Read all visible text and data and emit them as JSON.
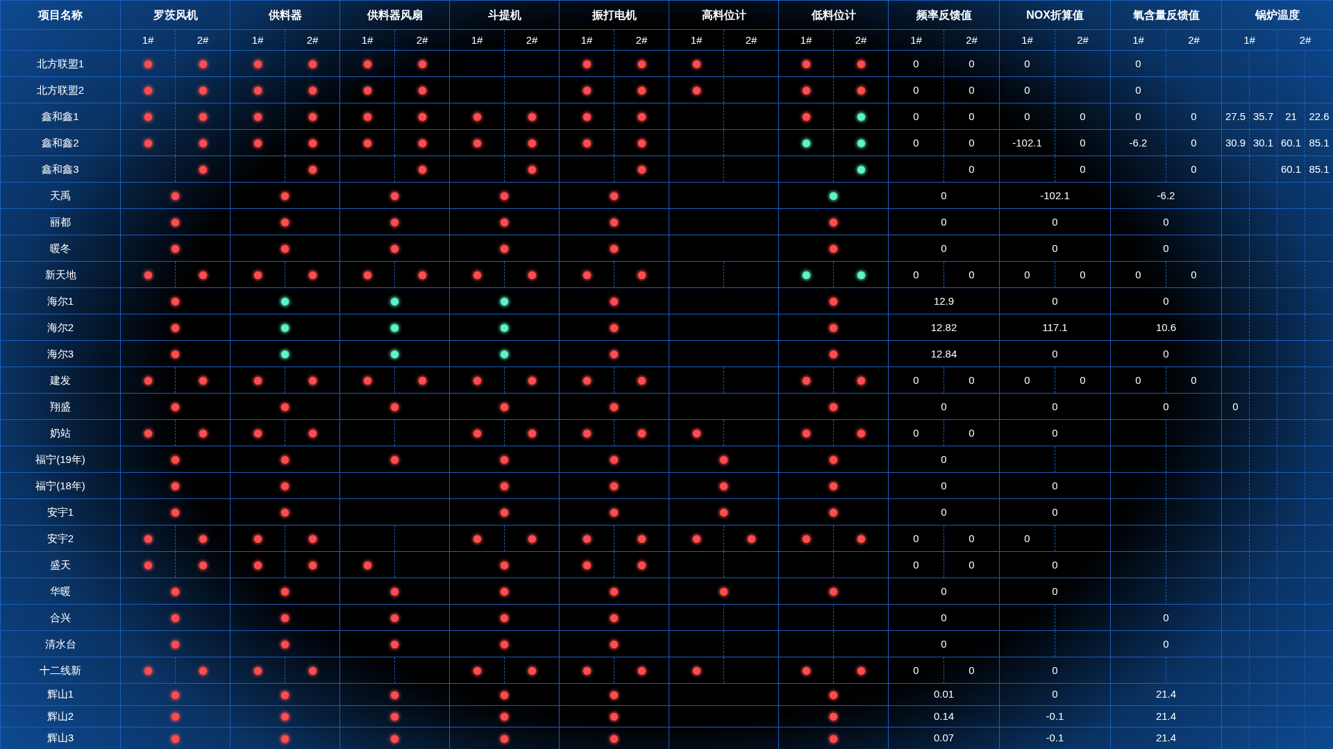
{
  "header": {
    "name_column": "项目名称",
    "indicator_groups": [
      {
        "title": "罗茨风机",
        "subs": [
          "1#",
          "2#"
        ]
      },
      {
        "title": "供料器",
        "subs": [
          "1#",
          "2#"
        ]
      },
      {
        "title": "供料器风扇",
        "subs": [
          "1#",
          "2#"
        ]
      },
      {
        "title": "斗提机",
        "subs": [
          "1#",
          "2#"
        ]
      },
      {
        "title": "振打电机",
        "subs": [
          "1#",
          "2#"
        ]
      },
      {
        "title": "高料位计",
        "subs": [
          "1#",
          "2#"
        ]
      },
      {
        "title": "低料位计",
        "subs": [
          "1#",
          "2#"
        ]
      }
    ],
    "reading_groups": [
      {
        "title": "频率反馈值",
        "subs": [
          "1#",
          "2#"
        ]
      },
      {
        "title": "NOX折算值",
        "subs": [
          "1#",
          "2#"
        ]
      },
      {
        "title": "氧含量反馈值",
        "subs": [
          "1#",
          "2#"
        ]
      }
    ],
    "temperature_group": {
      "title": "锅炉温度",
      "subs": [
        "1#",
        "2#"
      ]
    }
  },
  "rows": [
    {
      "name": "北方联盟1",
      "indicators": [
        {
          "split": true,
          "first": {
            "color": "#ff4d4f"
          },
          "second": {
            "color": "#ff4d4f"
          }
        },
        {
          "split": true,
          "first": {
            "color": "#ff4d4f"
          },
          "second": {
            "color": "#ff4d4f"
          }
        },
        {
          "split": true,
          "first": {
            "color": "#ff4d4f"
          },
          "second": {
            "color": "#ff4d4f"
          }
        },
        {
          "split": true
        },
        {
          "split": true,
          "first": {
            "color": "#ff4d4f"
          },
          "second": {
            "color": "#ff4d4f"
          }
        },
        {
          "split": true,
          "first": {
            "color": "#ff4d4f"
          }
        },
        {
          "split": true,
          "first": {
            "color": "#ff4d4f"
          },
          "second": {
            "color": "#ff4d4f"
          }
        }
      ],
      "readings": [
        {
          "split": true,
          "first": "0",
          "second": "0"
        },
        {
          "split": true,
          "first": "0"
        },
        {
          "split": true,
          "first": "0"
        }
      ]
    },
    {
      "name": "北方联盟2",
      "indicators": [
        {
          "split": true,
          "first": {
            "color": "#ff4d4f"
          },
          "second": {
            "color": "#ff4d4f"
          }
        },
        {
          "split": true,
          "first": {
            "color": "#ff4d4f"
          },
          "second": {
            "color": "#ff4d4f"
          }
        },
        {
          "split": true,
          "first": {
            "color": "#ff4d4f"
          },
          "second": {
            "color": "#ff4d4f"
          }
        },
        {
          "split": true
        },
        {
          "split": true,
          "first": {
            "color": "#ff4d4f"
          },
          "second": {
            "color": "#ff4d4f"
          }
        },
        {
          "split": true,
          "first": {
            "color": "#ff4d4f"
          }
        },
        {
          "split": true,
          "first": {
            "color": "#ff4d4f"
          },
          "second": {
            "color": "#ff4d4f"
          }
        }
      ],
      "readings": [
        {
          "split": true,
          "first": "0",
          "second": "0"
        },
        {
          "split": true,
          "first": "0"
        },
        {
          "split": true,
          "first": "0"
        }
      ]
    },
    {
      "name": "鑫和鑫1",
      "indicators": [
        {
          "split": true,
          "first": {
            "color": "#ff4d4f"
          },
          "second": {
            "color": "#ff4d4f"
          }
        },
        {
          "split": true,
          "first": {
            "color": "#ff4d4f"
          },
          "second": {
            "color": "#ff4d4f"
          }
        },
        {
          "split": true,
          "first": {
            "color": "#ff4d4f"
          },
          "second": {
            "color": "#ff4d4f"
          }
        },
        {
          "split": true,
          "first": {
            "color": "#ff4d4f"
          },
          "second": {
            "color": "#ff4d4f"
          }
        },
        {
          "split": true,
          "first": {
            "color": "#ff4d4f"
          },
          "second": {
            "color": "#ff4d4f"
          }
        },
        {
          "split": true
        },
        {
          "split": true,
          "first": {
            "color": "#ff4d4f"
          },
          "second": {
            "color": "#5ff3c8"
          }
        }
      ],
      "readings": [
        {
          "split": true,
          "first": "0",
          "second": "0"
        },
        {
          "split": true,
          "first": "0",
          "second": "0"
        },
        {
          "split": true,
          "first": "0",
          "second": "0"
        }
      ],
      "boiler_temps": {
        "column_1": "27.5",
        "column_2": "35.7",
        "column_3": "21",
        "column_4": "22.6"
      }
    },
    {
      "name": "鑫和鑫2",
      "indicators": [
        {
          "split": true,
          "first": {
            "color": "#ff4d4f"
          },
          "second": {
            "color": "#ff4d4f"
          }
        },
        {
          "split": true,
          "first": {
            "color": "#ff4d4f"
          },
          "second": {
            "color": "#ff4d4f"
          }
        },
        {
          "split": true,
          "first": {
            "color": "#ff4d4f"
          },
          "second": {
            "color": "#ff4d4f"
          }
        },
        {
          "split": true,
          "first": {
            "color": "#ff4d4f"
          },
          "second": {
            "color": "#ff4d4f"
          }
        },
        {
          "split": true,
          "first": {
            "color": "#ff4d4f"
          },
          "second": {
            "color": "#ff4d4f"
          }
        },
        {
          "split": true
        },
        {
          "split": true,
          "first": {
            "color": "#5ff3c8"
          },
          "second": {
            "color": "#5ff3c8"
          }
        }
      ],
      "readings": [
        {
          "split": true,
          "first": "0",
          "second": "0"
        },
        {
          "split": true,
          "first": "-102.1",
          "second": "0"
        },
        {
          "split": true,
          "first": "-6.2",
          "second": "0"
        }
      ],
      "boiler_temps": {
        "column_1": "30.9",
        "column_2": "30.1",
        "column_3": "60.1",
        "column_4": "85.1"
      }
    },
    {
      "name": "鑫和鑫3",
      "indicators": [
        {
          "split": true,
          "second": {
            "color": "#ff4d4f"
          }
        },
        {
          "split": true,
          "second": {
            "color": "#ff4d4f"
          }
        },
        {
          "split": true,
          "second": {
            "color": "#ff4d4f"
          }
        },
        {
          "split": true,
          "second": {
            "color": "#ff4d4f"
          }
        },
        {
          "split": true,
          "second": {
            "color": "#ff4d4f"
          }
        },
        {
          "split": true
        },
        {
          "split": true,
          "second": {
            "color": "#5ff3c8"
          }
        }
      ],
      "readings": [
        {
          "split": true,
          "second": "0"
        },
        {
          "split": true,
          "second": "0"
        },
        {
          "split": true,
          "second": "0"
        }
      ],
      "boiler_temps": {
        "column_3": "60.1",
        "column_4": "85.1"
      }
    },
    {
      "name": "天禹",
      "indicators": [
        {
          "split": false,
          "dot": {
            "color": "#ff4d4f"
          }
        },
        {
          "split": false,
          "dot": {
            "color": "#ff4d4f"
          }
        },
        {
          "split": false,
          "dot": {
            "color": "#ff4d4f"
          }
        },
        {
          "split": false,
          "dot": {
            "color": "#ff4d4f"
          }
        },
        {
          "split": false,
          "dot": {
            "color": "#ff4d4f"
          }
        },
        {
          "split": false
        },
        {
          "split": false,
          "dot": {
            "color": "#5ff3c8"
          }
        }
      ],
      "readings": [
        {
          "split": false,
          "value": "0"
        },
        {
          "split": false,
          "value": "-102.1"
        },
        {
          "split": false,
          "value": "-6.2"
        }
      ]
    },
    {
      "name": "丽都",
      "indicators": [
        {
          "split": false,
          "dot": {
            "color": "#ff4d4f"
          }
        },
        {
          "split": false,
          "dot": {
            "color": "#ff4d4f"
          }
        },
        {
          "split": false,
          "dot": {
            "color": "#ff4d4f"
          }
        },
        {
          "split": false,
          "dot": {
            "color": "#ff4d4f"
          }
        },
        {
          "split": false,
          "dot": {
            "color": "#ff4d4f"
          }
        },
        {
          "split": false
        },
        {
          "split": false,
          "dot": {
            "color": "#ff4d4f"
          }
        }
      ],
      "readings": [
        {
          "split": false,
          "value": "0"
        },
        {
          "split": false,
          "value": "0"
        },
        {
          "split": false,
          "value": "0"
        }
      ]
    },
    {
      "name": "暖冬",
      "indicators": [
        {
          "split": false,
          "dot": {
            "color": "#ff4d4f"
          }
        },
        {
          "split": false,
          "dot": {
            "color": "#ff4d4f"
          }
        },
        {
          "split": false,
          "dot": {
            "color": "#ff4d4f"
          }
        },
        {
          "split": false,
          "dot": {
            "color": "#ff4d4f"
          }
        },
        {
          "split": false,
          "dot": {
            "color": "#ff4d4f"
          }
        },
        {
          "split": false
        },
        {
          "split": false,
          "dot": {
            "color": "#ff4d4f"
          }
        }
      ],
      "readings": [
        {
          "split": false,
          "value": "0"
        },
        {
          "split": false,
          "value": "0"
        },
        {
          "split": false,
          "value": "0"
        }
      ]
    },
    {
      "name": "新天地",
      "indicators": [
        {
          "split": true,
          "first": {
            "color": "#ff4d4f"
          },
          "second": {
            "color": "#ff4d4f"
          }
        },
        {
          "split": true,
          "first": {
            "color": "#ff4d4f"
          },
          "second": {
            "color": "#ff4d4f"
          }
        },
        {
          "split": true,
          "first": {
            "color": "#ff4d4f"
          },
          "second": {
            "color": "#ff4d4f"
          }
        },
        {
          "split": true,
          "first": {
            "color": "#ff4d4f"
          },
          "second": {
            "color": "#ff4d4f"
          }
        },
        {
          "split": true,
          "first": {
            "color": "#ff4d4f"
          },
          "second": {
            "color": "#ff4d4f"
          }
        },
        {
          "split": true
        },
        {
          "split": true,
          "first": {
            "color": "#5ff3c8"
          },
          "second": {
            "color": "#5ff3c8"
          }
        }
      ],
      "readings": [
        {
          "split": true,
          "first": "0",
          "second": "0"
        },
        {
          "split": true,
          "first": "0",
          "second": "0"
        },
        {
          "split": true,
          "first": "0",
          "second": "0"
        }
      ]
    },
    {
      "name": "海尔1",
      "indicators": [
        {
          "split": false,
          "dot": {
            "color": "#ff4d4f"
          }
        },
        {
          "split": false,
          "dot": {
            "color": "#5ff3c8"
          }
        },
        {
          "split": false,
          "dot": {
            "color": "#5ff3c8"
          }
        },
        {
          "split": false,
          "dot": {
            "color": "#5ff3c8"
          }
        },
        {
          "split": false,
          "dot": {
            "color": "#ff4d4f"
          }
        },
        {
          "split": false
        },
        {
          "split": false,
          "dot": {
            "color": "#ff4d4f"
          }
        }
      ],
      "readings": [
        {
          "split": false,
          "value": "12.9"
        },
        {
          "split": false,
          "value": "0"
        },
        {
          "split": false,
          "value": "0"
        }
      ]
    },
    {
      "name": "海尔2",
      "indicators": [
        {
          "split": false,
          "dot": {
            "color": "#ff4d4f"
          }
        },
        {
          "split": false,
          "dot": {
            "color": "#5ff3c8"
          }
        },
        {
          "split": false,
          "dot": {
            "color": "#5ff3c8"
          }
        },
        {
          "split": false,
          "dot": {
            "color": "#5ff3c8"
          }
        },
        {
          "split": false,
          "dot": {
            "color": "#ff4d4f"
          }
        },
        {
          "split": false
        },
        {
          "split": false,
          "dot": {
            "color": "#ff4d4f"
          }
        }
      ],
      "readings": [
        {
          "split": false,
          "value": "12.82"
        },
        {
          "split": false,
          "value": "117.1"
        },
        {
          "split": false,
          "value": "10.6"
        }
      ]
    },
    {
      "name": "海尔3",
      "indicators": [
        {
          "split": false,
          "dot": {
            "color": "#ff4d4f"
          }
        },
        {
          "split": false,
          "dot": {
            "color": "#5ff3c8"
          }
        },
        {
          "split": false,
          "dot": {
            "color": "#5ff3c8"
          }
        },
        {
          "split": false,
          "dot": {
            "color": "#5ff3c8"
          }
        },
        {
          "split": false,
          "dot": {
            "color": "#ff4d4f"
          }
        },
        {
          "split": false
        },
        {
          "split": false,
          "dot": {
            "color": "#ff4d4f"
          }
        }
      ],
      "readings": [
        {
          "split": false,
          "value": "12.84"
        },
        {
          "split": false,
          "value": "0"
        },
        {
          "split": false,
          "value": "0"
        }
      ]
    },
    {
      "name": "建发",
      "indicators": [
        {
          "split": true,
          "first": {
            "color": "#ff4d4f"
          },
          "second": {
            "color": "#ff4d4f"
          }
        },
        {
          "split": true,
          "first": {
            "color": "#ff4d4f"
          },
          "second": {
            "color": "#ff4d4f"
          }
        },
        {
          "split": true,
          "first": {
            "color": "#ff4d4f"
          },
          "second": {
            "color": "#ff4d4f"
          }
        },
        {
          "split": true,
          "first": {
            "color": "#ff4d4f"
          },
          "second": {
            "color": "#ff4d4f"
          }
        },
        {
          "split": true,
          "first": {
            "color": "#ff4d4f"
          },
          "second": {
            "color": "#ff4d4f"
          }
        },
        {
          "split": true
        },
        {
          "split": true,
          "first": {
            "color": "#ff4d4f"
          },
          "second": {
            "color": "#ff4d4f"
          }
        }
      ],
      "readings": [
        {
          "split": true,
          "first": "0",
          "second": "0"
        },
        {
          "split": true,
          "first": "0",
          "second": "0"
        },
        {
          "split": true,
          "first": "0",
          "second": "0"
        }
      ]
    },
    {
      "name": "翔盛",
      "indicators": [
        {
          "split": false,
          "dot": {
            "color": "#ff4d4f"
          }
        },
        {
          "split": false,
          "dot": {
            "color": "#ff4d4f"
          }
        },
        {
          "split": false,
          "dot": {
            "color": "#ff4d4f"
          }
        },
        {
          "split": false,
          "dot": {
            "color": "#ff4d4f"
          }
        },
        {
          "split": false,
          "dot": {
            "color": "#ff4d4f"
          }
        },
        {
          "split": false
        },
        {
          "split": false,
          "dot": {
            "color": "#ff4d4f"
          }
        }
      ],
      "readings": [
        {
          "split": false,
          "value": "0"
        },
        {
          "split": false,
          "value": "0"
        },
        {
          "split": false,
          "value": "0"
        }
      ],
      "boiler_temps": {
        "column_1": "0"
      }
    },
    {
      "name": "奶站",
      "indicators": [
        {
          "split": true,
          "first": {
            "color": "#ff4d4f"
          },
          "second": {
            "color": "#ff4d4f"
          }
        },
        {
          "split": true,
          "first": {
            "color": "#ff4d4f"
          },
          "second": {
            "color": "#ff4d4f"
          }
        },
        {
          "split": true
        },
        {
          "split": true,
          "first": {
            "color": "#ff4d4f"
          },
          "second": {
            "color": "#ff4d4f"
          }
        },
        {
          "split": true,
          "first": {
            "color": "#ff4d4f"
          },
          "second": {
            "color": "#ff4d4f"
          }
        },
        {
          "split": true,
          "first": {
            "color": "#ff4d4f"
          }
        },
        {
          "split": true,
          "first": {
            "color": "#ff4d4f"
          },
          "second": {
            "color": "#ff4d4f"
          }
        }
      ],
      "readings": [
        {
          "split": true,
          "first": "0",
          "second": "0"
        },
        {
          "split": false,
          "value": "0"
        },
        {
          "split": true
        }
      ]
    },
    {
      "name": "福宁(19年)",
      "indicators": [
        {
          "split": false,
          "dot": {
            "color": "#ff4d4f"
          }
        },
        {
          "split": false,
          "dot": {
            "color": "#ff4d4f"
          }
        },
        {
          "split": false,
          "dot": {
            "color": "#ff4d4f"
          }
        },
        {
          "split": false,
          "dot": {
            "color": "#ff4d4f"
          }
        },
        {
          "split": false,
          "dot": {
            "color": "#ff4d4f"
          }
        },
        {
          "split": false,
          "dot": {
            "color": "#ff4d4f"
          }
        },
        {
          "split": false,
          "dot": {
            "color": "#ff4d4f"
          }
        }
      ],
      "readings": [
        {
          "split": false,
          "value": "0"
        },
        {
          "split": true
        },
        {
          "split": true
        }
      ]
    },
    {
      "name": "福宁(18年)",
      "indicators": [
        {
          "split": false,
          "dot": {
            "color": "#ff4d4f"
          }
        },
        {
          "split": false,
          "dot": {
            "color": "#ff4d4f"
          }
        },
        {
          "split": false
        },
        {
          "split": false,
          "dot": {
            "color": "#ff4d4f"
          }
        },
        {
          "split": false,
          "dot": {
            "color": "#ff4d4f"
          }
        },
        {
          "split": false,
          "dot": {
            "color": "#ff4d4f"
          }
        },
        {
          "split": false,
          "dot": {
            "color": "#ff4d4f"
          }
        }
      ],
      "readings": [
        {
          "split": false,
          "value": "0"
        },
        {
          "split": false,
          "value": "0"
        },
        {
          "split": true
        }
      ]
    },
    {
      "name": "安宇1",
      "indicators": [
        {
          "split": false,
          "dot": {
            "color": "#ff4d4f"
          }
        },
        {
          "split": false,
          "dot": {
            "color": "#ff4d4f"
          }
        },
        {
          "split": false
        },
        {
          "split": false,
          "dot": {
            "color": "#ff4d4f"
          }
        },
        {
          "split": false,
          "dot": {
            "color": "#ff4d4f"
          }
        },
        {
          "split": false,
          "dot": {
            "color": "#ff4d4f"
          }
        },
        {
          "split": false,
          "dot": {
            "color": "#ff4d4f"
          }
        }
      ],
      "readings": [
        {
          "split": false,
          "value": "0"
        },
        {
          "split": false,
          "value": "0"
        },
        {
          "split": true
        }
      ]
    },
    {
      "name": "安宇2",
      "indicators": [
        {
          "split": true,
          "first": {
            "color": "#ff4d4f"
          },
          "second": {
            "color": "#ff4d4f"
          }
        },
        {
          "split": true,
          "first": {
            "color": "#ff4d4f"
          },
          "second": {
            "color": "#ff4d4f"
          }
        },
        {
          "split": true
        },
        {
          "split": true,
          "first": {
            "color": "#ff4d4f"
          },
          "second": {
            "color": "#ff4d4f"
          }
        },
        {
          "split": true,
          "first": {
            "color": "#ff4d4f"
          },
          "second": {
            "color": "#ff4d4f"
          }
        },
        {
          "split": true,
          "first": {
            "color": "#ff4d4f"
          },
          "second": {
            "color": "#ff4d4f"
          }
        },
        {
          "split": true,
          "first": {
            "color": "#ff4d4f"
          },
          "second": {
            "color": "#ff4d4f"
          }
        }
      ],
      "readings": [
        {
          "split": true,
          "first": "0",
          "second": "0"
        },
        {
          "split": true,
          "first": "0"
        },
        {
          "split": true
        }
      ]
    },
    {
      "name": "盛天",
      "indicators": [
        {
          "split": true,
          "first": {
            "color": "#ff4d4f"
          },
          "second": {
            "color": "#ff4d4f"
          }
        },
        {
          "split": true,
          "first": {
            "color": "#ff4d4f"
          },
          "second": {
            "color": "#ff4d4f"
          }
        },
        {
          "split": true,
          "first": {
            "color": "#ff4d4f"
          }
        },
        {
          "split": false,
          "dot": {
            "color": "#ff4d4f"
          }
        },
        {
          "split": true,
          "first": {
            "color": "#ff4d4f"
          },
          "second": {
            "color": "#ff4d4f"
          }
        },
        {
          "split": true
        },
        {
          "split": true
        }
      ],
      "readings": [
        {
          "split": true,
          "first": "0",
          "second": "0"
        },
        {
          "split": false,
          "value": "0"
        },
        {
          "split": true
        }
      ]
    },
    {
      "name": "华暖",
      "indicators": [
        {
          "split": false,
          "dot": {
            "color": "#ff4d4f"
          }
        },
        {
          "split": false,
          "dot": {
            "color": "#ff4d4f"
          }
        },
        {
          "split": false,
          "dot": {
            "color": "#ff4d4f"
          }
        },
        {
          "split": false,
          "dot": {
            "color": "#ff4d4f"
          }
        },
        {
          "split": false,
          "dot": {
            "color": "#ff4d4f"
          }
        },
        {
          "split": false,
          "dot": {
            "color": "#ff4d4f"
          }
        },
        {
          "split": false,
          "dot": {
            "color": "#ff4d4f"
          }
        }
      ],
      "readings": [
        {
          "split": false,
          "value": "0"
        },
        {
          "split": false,
          "value": "0"
        },
        {
          "split": true
        }
      ]
    },
    {
      "name": "合兴",
      "indicators": [
        {
          "split": false,
          "dot": {
            "color": "#ff4d4f"
          }
        },
        {
          "split": false,
          "dot": {
            "color": "#ff4d4f"
          }
        },
        {
          "split": false,
          "dot": {
            "color": "#ff4d4f"
          }
        },
        {
          "split": false,
          "dot": {
            "color": "#ff4d4f"
          }
        },
        {
          "split": false,
          "dot": {
            "color": "#ff4d4f"
          }
        },
        {
          "split": true
        },
        {
          "split": true
        }
      ],
      "readings": [
        {
          "split": false,
          "value": "0"
        },
        {
          "split": true
        },
        {
          "split": false,
          "value": "0"
        }
      ]
    },
    {
      "name": "清水台",
      "indicators": [
        {
          "split": false,
          "dot": {
            "color": "#ff4d4f"
          }
        },
        {
          "split": false,
          "dot": {
            "color": "#ff4d4f"
          }
        },
        {
          "split": false,
          "dot": {
            "color": "#ff4d4f"
          }
        },
        {
          "split": false,
          "dot": {
            "color": "#ff4d4f"
          }
        },
        {
          "split": false,
          "dot": {
            "color": "#ff4d4f"
          }
        },
        {
          "split": true
        },
        {
          "split": true
        }
      ],
      "readings": [
        {
          "split": false,
          "value": "0"
        },
        {
          "split": true
        },
        {
          "split": false,
          "value": "0"
        }
      ]
    },
    {
      "name": "十二线新",
      "indicators": [
        {
          "split": true,
          "first": {
            "color": "#ff4d4f"
          },
          "second": {
            "color": "#ff4d4f"
          }
        },
        {
          "split": true,
          "first": {
            "color": "#ff4d4f"
          },
          "second": {
            "color": "#ff4d4f"
          }
        },
        {
          "split": true
        },
        {
          "split": true,
          "first": {
            "color": "#ff4d4f"
          },
          "second": {
            "color": "#ff4d4f"
          }
        },
        {
          "split": true,
          "first": {
            "color": "#ff4d4f"
          },
          "second": {
            "color": "#ff4d4f"
          }
        },
        {
          "split": true,
          "first": {
            "color": "#ff4d4f"
          }
        },
        {
          "split": true,
          "first": {
            "color": "#ff4d4f"
          },
          "second": {
            "color": "#ff4d4f"
          }
        }
      ],
      "readings": [
        {
          "split": true,
          "first": "0",
          "second": "0"
        },
        {
          "split": false,
          "value": "0"
        },
        {
          "split": true
        }
      ]
    },
    {
      "name": "辉山1",
      "indicators": [
        {
          "split": false,
          "dot": {
            "color": "#ff4d4f"
          }
        },
        {
          "split": false,
          "dot": {
            "color": "#ff4d4f"
          }
        },
        {
          "split": false,
          "dot": {
            "color": "#ff4d4f"
          }
        },
        {
          "split": false,
          "dot": {
            "color": "#ff4d4f"
          }
        },
        {
          "split": false,
          "dot": {
            "color": "#ff4d4f"
          }
        },
        {
          "split": false
        },
        {
          "split": false,
          "dot": {
            "color": "#ff4d4f"
          }
        }
      ],
      "readings": [
        {
          "split": false,
          "value": "0.01"
        },
        {
          "split": false,
          "value": "0"
        },
        {
          "split": false,
          "value": "21.4"
        }
      ]
    },
    {
      "name": "辉山2",
      "indicators": [
        {
          "split": false,
          "dot": {
            "color": "#ff4d4f"
          }
        },
        {
          "split": false,
          "dot": {
            "color": "#ff4d4f"
          }
        },
        {
          "split": false,
          "dot": {
            "color": "#ff4d4f"
          }
        },
        {
          "split": false,
          "dot": {
            "color": "#ff4d4f"
          }
        },
        {
          "split": false,
          "dot": {
            "color": "#ff4d4f"
          }
        },
        {
          "split": false
        },
        {
          "split": false,
          "dot": {
            "color": "#ff4d4f"
          }
        }
      ],
      "readings": [
        {
          "split": false,
          "value": "0.14"
        },
        {
          "split": false,
          "value": "-0.1"
        },
        {
          "split": false,
          "value": "21.4"
        }
      ]
    },
    {
      "name": "辉山3",
      "indicators": [
        {
          "split": false,
          "dot": {
            "color": "#ff4d4f"
          }
        },
        {
          "split": false,
          "dot": {
            "color": "#ff4d4f"
          }
        },
        {
          "split": false,
          "dot": {
            "color": "#ff4d4f"
          }
        },
        {
          "split": false,
          "dot": {
            "color": "#ff4d4f"
          }
        },
        {
          "split": false,
          "dot": {
            "color": "#ff4d4f"
          }
        },
        {
          "split": false
        },
        {
          "split": false,
          "dot": {
            "color": "#ff4d4f"
          }
        }
      ],
      "readings": [
        {
          "split": false,
          "value": "0.07"
        },
        {
          "split": false,
          "value": "-0.1"
        },
        {
          "split": false,
          "value": "21.4"
        }
      ]
    }
  ]
}
